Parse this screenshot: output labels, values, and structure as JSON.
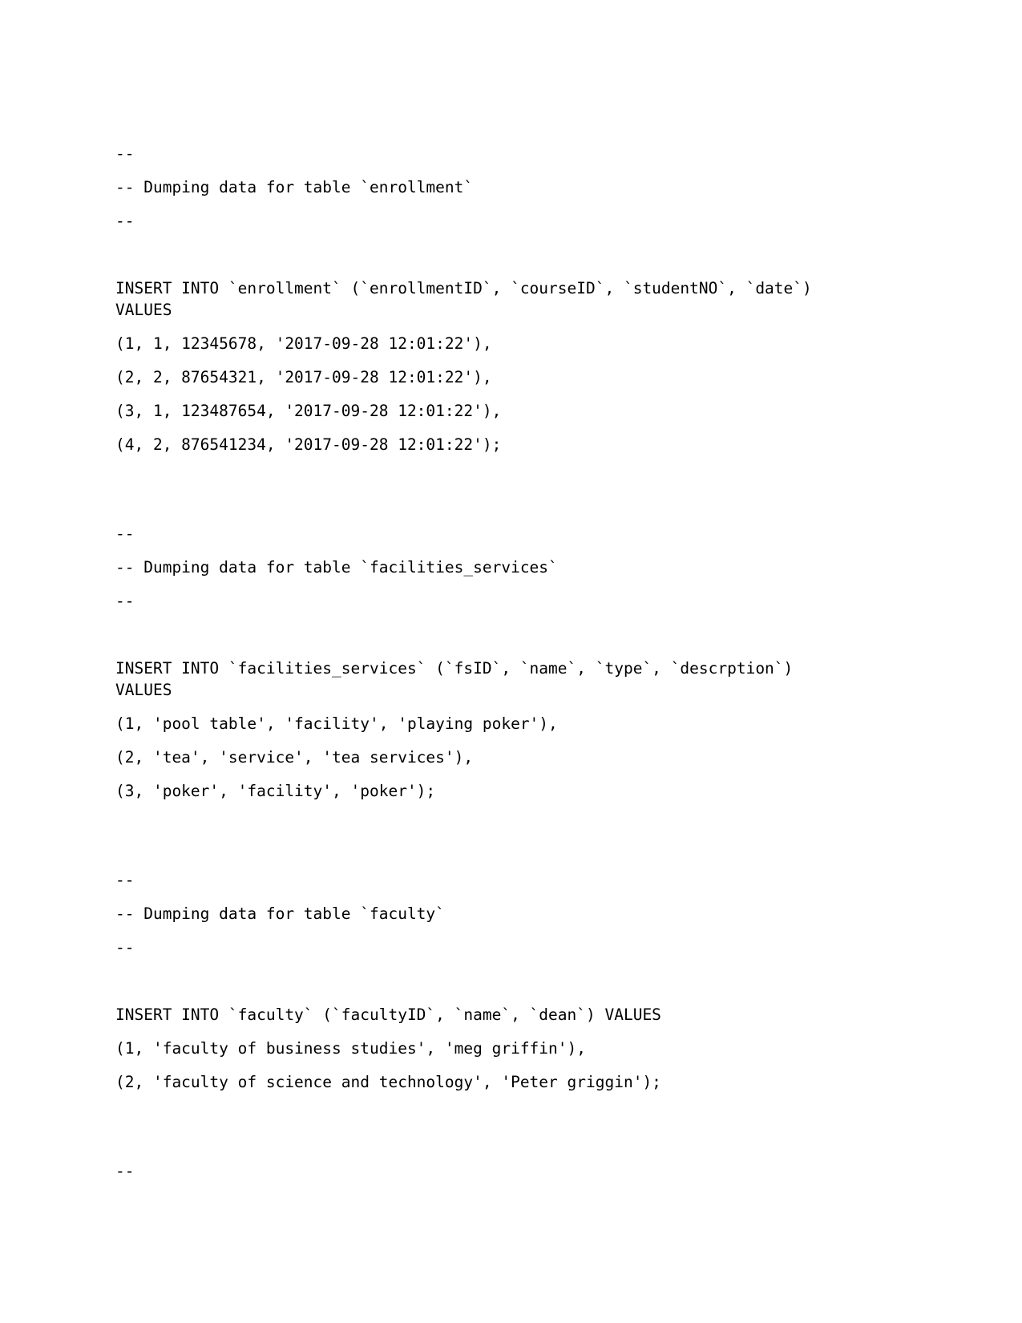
{
  "document": {
    "type": "sql-dump",
    "blocks": [
      {
        "id": "enrollment-comment-open",
        "text": "--"
      },
      {
        "id": "enrollment-comment-title",
        "text": "-- Dumping data for table `enrollment`"
      },
      {
        "id": "enrollment-comment-close",
        "text": "--"
      },
      {
        "id": "enrollment-insert",
        "text": "INSERT INTO `enrollment` (`enrollmentID`, `courseID`, `studentNO`, `date`) VALUES"
      },
      {
        "id": "enrollment-row-1",
        "text": "(1, 1, 12345678, '2017-09-28 12:01:22'),"
      },
      {
        "id": "enrollment-row-2",
        "text": "(2, 2, 87654321, '2017-09-28 12:01:22'),"
      },
      {
        "id": "enrollment-row-3",
        "text": "(3, 1, 123487654, '2017-09-28 12:01:22'),"
      },
      {
        "id": "enrollment-row-4",
        "text": "(4, 2, 876541234, '2017-09-28 12:01:22');"
      },
      {
        "id": "facilities-comment-open",
        "text": "--"
      },
      {
        "id": "facilities-comment-title",
        "text": "-- Dumping data for table `facilities_services`"
      },
      {
        "id": "facilities-comment-close",
        "text": "--"
      },
      {
        "id": "facilities-insert",
        "text": "INSERT INTO `facilities_services` (`fsID`, `name`, `type`, `descrption`) VALUES"
      },
      {
        "id": "facilities-row-1",
        "text": "(1, 'pool table', 'facility', 'playing poker'),"
      },
      {
        "id": "facilities-row-2",
        "text": "(2, 'tea', 'service', 'tea services'),"
      },
      {
        "id": "facilities-row-3",
        "text": "(3, 'poker', 'facility', 'poker');"
      },
      {
        "id": "faculty-comment-open",
        "text": "--"
      },
      {
        "id": "faculty-comment-title",
        "text": "-- Dumping data for table `faculty`"
      },
      {
        "id": "faculty-comment-close",
        "text": "--"
      },
      {
        "id": "faculty-insert",
        "text": "INSERT INTO `faculty` (`facultyID`, `name`, `dean`) VALUES"
      },
      {
        "id": "faculty-row-1",
        "text": "(1, 'faculty of business studies', 'meg griffin'),"
      },
      {
        "id": "faculty-row-2",
        "text": "(2, 'faculty of science and technology', 'Peter griggin');"
      },
      {
        "id": "trailing-comment",
        "text": "--"
      }
    ]
  }
}
